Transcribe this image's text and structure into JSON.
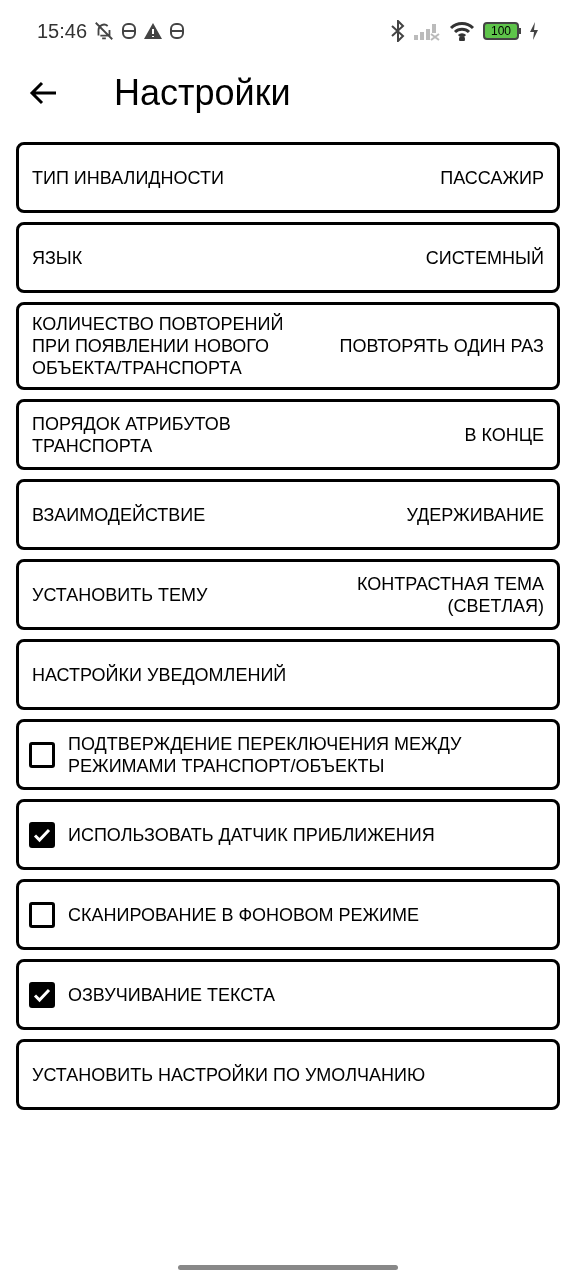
{
  "status_bar": {
    "time": "15:46",
    "battery": "100"
  },
  "title": "Настройки",
  "items": [
    {
      "kind": "option",
      "label": "ТИП ИНВАЛИДНОСТИ",
      "value": "ПАССАЖИР"
    },
    {
      "kind": "option",
      "label": "ЯЗЫК",
      "value": "СИСТЕМНЫЙ"
    },
    {
      "kind": "option",
      "label": "КОЛИЧЕСТВО ПОВТОРЕНИЙ ПРИ ПОЯВЛЕНИИ НОВОГО ОБЪЕКТА/ТРАНСПОРТА",
      "value": "ПОВТОРЯТЬ ОДИН РАЗ"
    },
    {
      "kind": "option",
      "label": "ПОРЯДОК АТРИБУТОВ ТРАНСПОРТА",
      "value": "В КОНЦЕ"
    },
    {
      "kind": "option",
      "label": "ВЗАИМОДЕЙСТВИЕ",
      "value": "УДЕРЖИВАНИЕ"
    },
    {
      "kind": "option",
      "label": "УСТАНОВИТЬ ТЕМУ",
      "value": "КОНТРАСТНАЯ ТЕМА (СВЕТЛАЯ)"
    },
    {
      "kind": "link",
      "label": "НАСТРОЙКИ УВЕДОМЛЕНИЙ"
    },
    {
      "kind": "checkbox",
      "label": "ПОДТВЕРЖДЕНИЕ ПЕРЕКЛЮЧЕНИЯ МЕЖДУ РЕЖИМАМИ ТРАНСПОРТ/ОБЪЕКТЫ",
      "checked": false
    },
    {
      "kind": "checkbox",
      "label": "ИСПОЛЬЗОВАТЬ ДАТЧИК ПРИБЛИЖЕНИЯ",
      "checked": true
    },
    {
      "kind": "checkbox",
      "label": "СКАНИРОВАНИЕ В ФОНОВОМ РЕЖИМЕ",
      "checked": false
    },
    {
      "kind": "checkbox",
      "label": "ОЗВУЧИВАНИЕ ТЕКСТА",
      "checked": true
    },
    {
      "kind": "link",
      "label": "УСТАНОВИТЬ НАСТРОЙКИ ПО УМОЛЧАНИЮ"
    }
  ]
}
